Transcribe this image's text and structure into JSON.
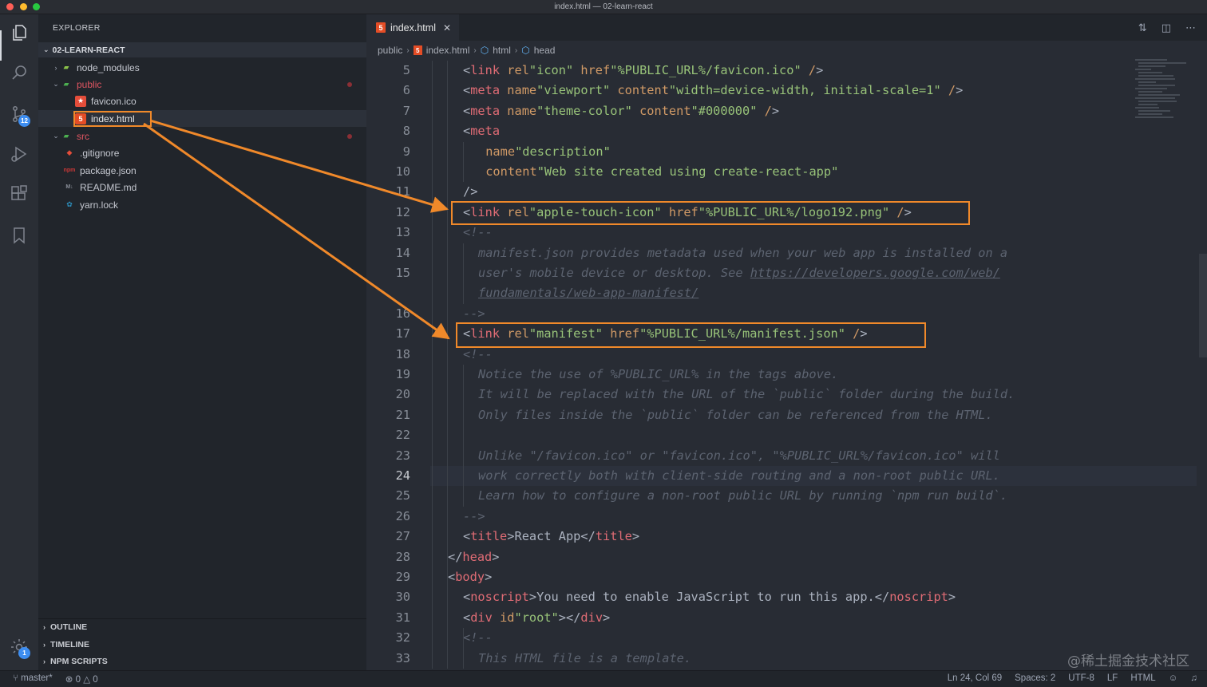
{
  "window": {
    "title": "index.html — 02-learn-react"
  },
  "activity_bar": {
    "source_control_badge": "12",
    "settings_badge": "1"
  },
  "sidebar": {
    "header": "EXPLORER",
    "folder": "02-LEARN-REACT",
    "tree": [
      {
        "label": "node_modules",
        "kind": "folder",
        "expanded": false,
        "icon": "node-folder-icon"
      },
      {
        "label": "public",
        "kind": "folder",
        "expanded": true,
        "icon": "public-folder-icon"
      },
      {
        "label": "favicon.ico",
        "kind": "file",
        "icon": "favicon-icon"
      },
      {
        "label": "index.html",
        "kind": "file",
        "icon": "html5-icon",
        "selected": true
      },
      {
        "label": "src",
        "kind": "folder",
        "expanded": true,
        "icon": "src-folder-icon"
      },
      {
        "label": ".gitignore",
        "kind": "file",
        "icon": "git-icon"
      },
      {
        "label": "package.json",
        "kind": "file",
        "icon": "npm-icon"
      },
      {
        "label": "README.md",
        "kind": "file",
        "icon": "markdown-icon"
      },
      {
        "label": "yarn.lock",
        "kind": "file",
        "icon": "yarn-icon"
      }
    ],
    "sections": [
      "OUTLINE",
      "TIMELINE",
      "NPM SCRIPTS"
    ]
  },
  "editor": {
    "tab": {
      "label": "index.html",
      "close": "✕"
    },
    "breadcrumb": [
      "public",
      "index.html",
      "html",
      "head"
    ],
    "current_line": 24,
    "lines": [
      {
        "n": "5",
        "text": "<link rel=\"icon\" href=\"%PUBLIC_URL%/favicon.ico\" />"
      },
      {
        "n": "6",
        "text": "<meta name=\"viewport\" content=\"width=device-width, initial-scale=1\" />"
      },
      {
        "n": "7",
        "text": "<meta name=\"theme-color\" content=\"#000000\" />"
      },
      {
        "n": "8",
        "text": "<meta"
      },
      {
        "n": "9",
        "text": "name=\"description\""
      },
      {
        "n": "10",
        "text": "content=\"Web site created using create-react-app\""
      },
      {
        "n": "11",
        "text": "/>"
      },
      {
        "n": "12",
        "text": "<link rel=\"apple-touch-icon\" href=\"%PUBLIC_URL%/logo192.png\" />"
      },
      {
        "n": "13",
        "text": "<!--"
      },
      {
        "n": "14",
        "text": "manifest.json provides metadata used when your web app is installed on a"
      },
      {
        "n": "15",
        "text": "user's mobile device or desktop. See https://developers.google.com/web/"
      },
      {
        "n": "",
        "text": "fundamentals/web-app-manifest/"
      },
      {
        "n": "16",
        "text": "-->"
      },
      {
        "n": "17",
        "text": "<link rel=\"manifest\" href=\"%PUBLIC_URL%/manifest.json\" />"
      },
      {
        "n": "18",
        "text": "<!--"
      },
      {
        "n": "19",
        "text": "Notice the use of %PUBLIC_URL% in the tags above."
      },
      {
        "n": "20",
        "text": "It will be replaced with the URL of the `public` folder during the build."
      },
      {
        "n": "21",
        "text": "Only files inside the `public` folder can be referenced from the HTML."
      },
      {
        "n": "22",
        "text": ""
      },
      {
        "n": "23",
        "text": "Unlike \"/favicon.ico\" or \"favicon.ico\", \"%PUBLIC_URL%/favicon.ico\" will"
      },
      {
        "n": "24",
        "text": "work correctly both with client-side routing and a non-root public URL."
      },
      {
        "n": "25",
        "text": "Learn how to configure a non-root public URL by running `npm run build`."
      },
      {
        "n": "26",
        "text": "-->"
      },
      {
        "n": "27",
        "text": "<title>React App</title>"
      },
      {
        "n": "28",
        "text": "</head>"
      },
      {
        "n": "29",
        "text": "<body>"
      },
      {
        "n": "30",
        "text": "<noscript>You need to enable JavaScript to run this app.</noscript>"
      },
      {
        "n": "31",
        "text": "<div id=\"root\"></div>"
      },
      {
        "n": "32",
        "text": "<!--"
      },
      {
        "n": "33",
        "text": "This HTML file is a template."
      }
    ]
  },
  "statusbar": {
    "branch": "master*",
    "errors": "0",
    "warnings": "0",
    "position": "Ln 24, Col 69",
    "spaces": "Spaces: 2",
    "encoding": "UTF-8",
    "eol": "LF",
    "language": "HTML"
  },
  "watermark": "@稀土掘金技术社区",
  "colors": {
    "annotation": "#f0892a",
    "tag": "#e06c75",
    "attr": "#d19a66",
    "string": "#98c379",
    "comment": "#5c6370"
  }
}
